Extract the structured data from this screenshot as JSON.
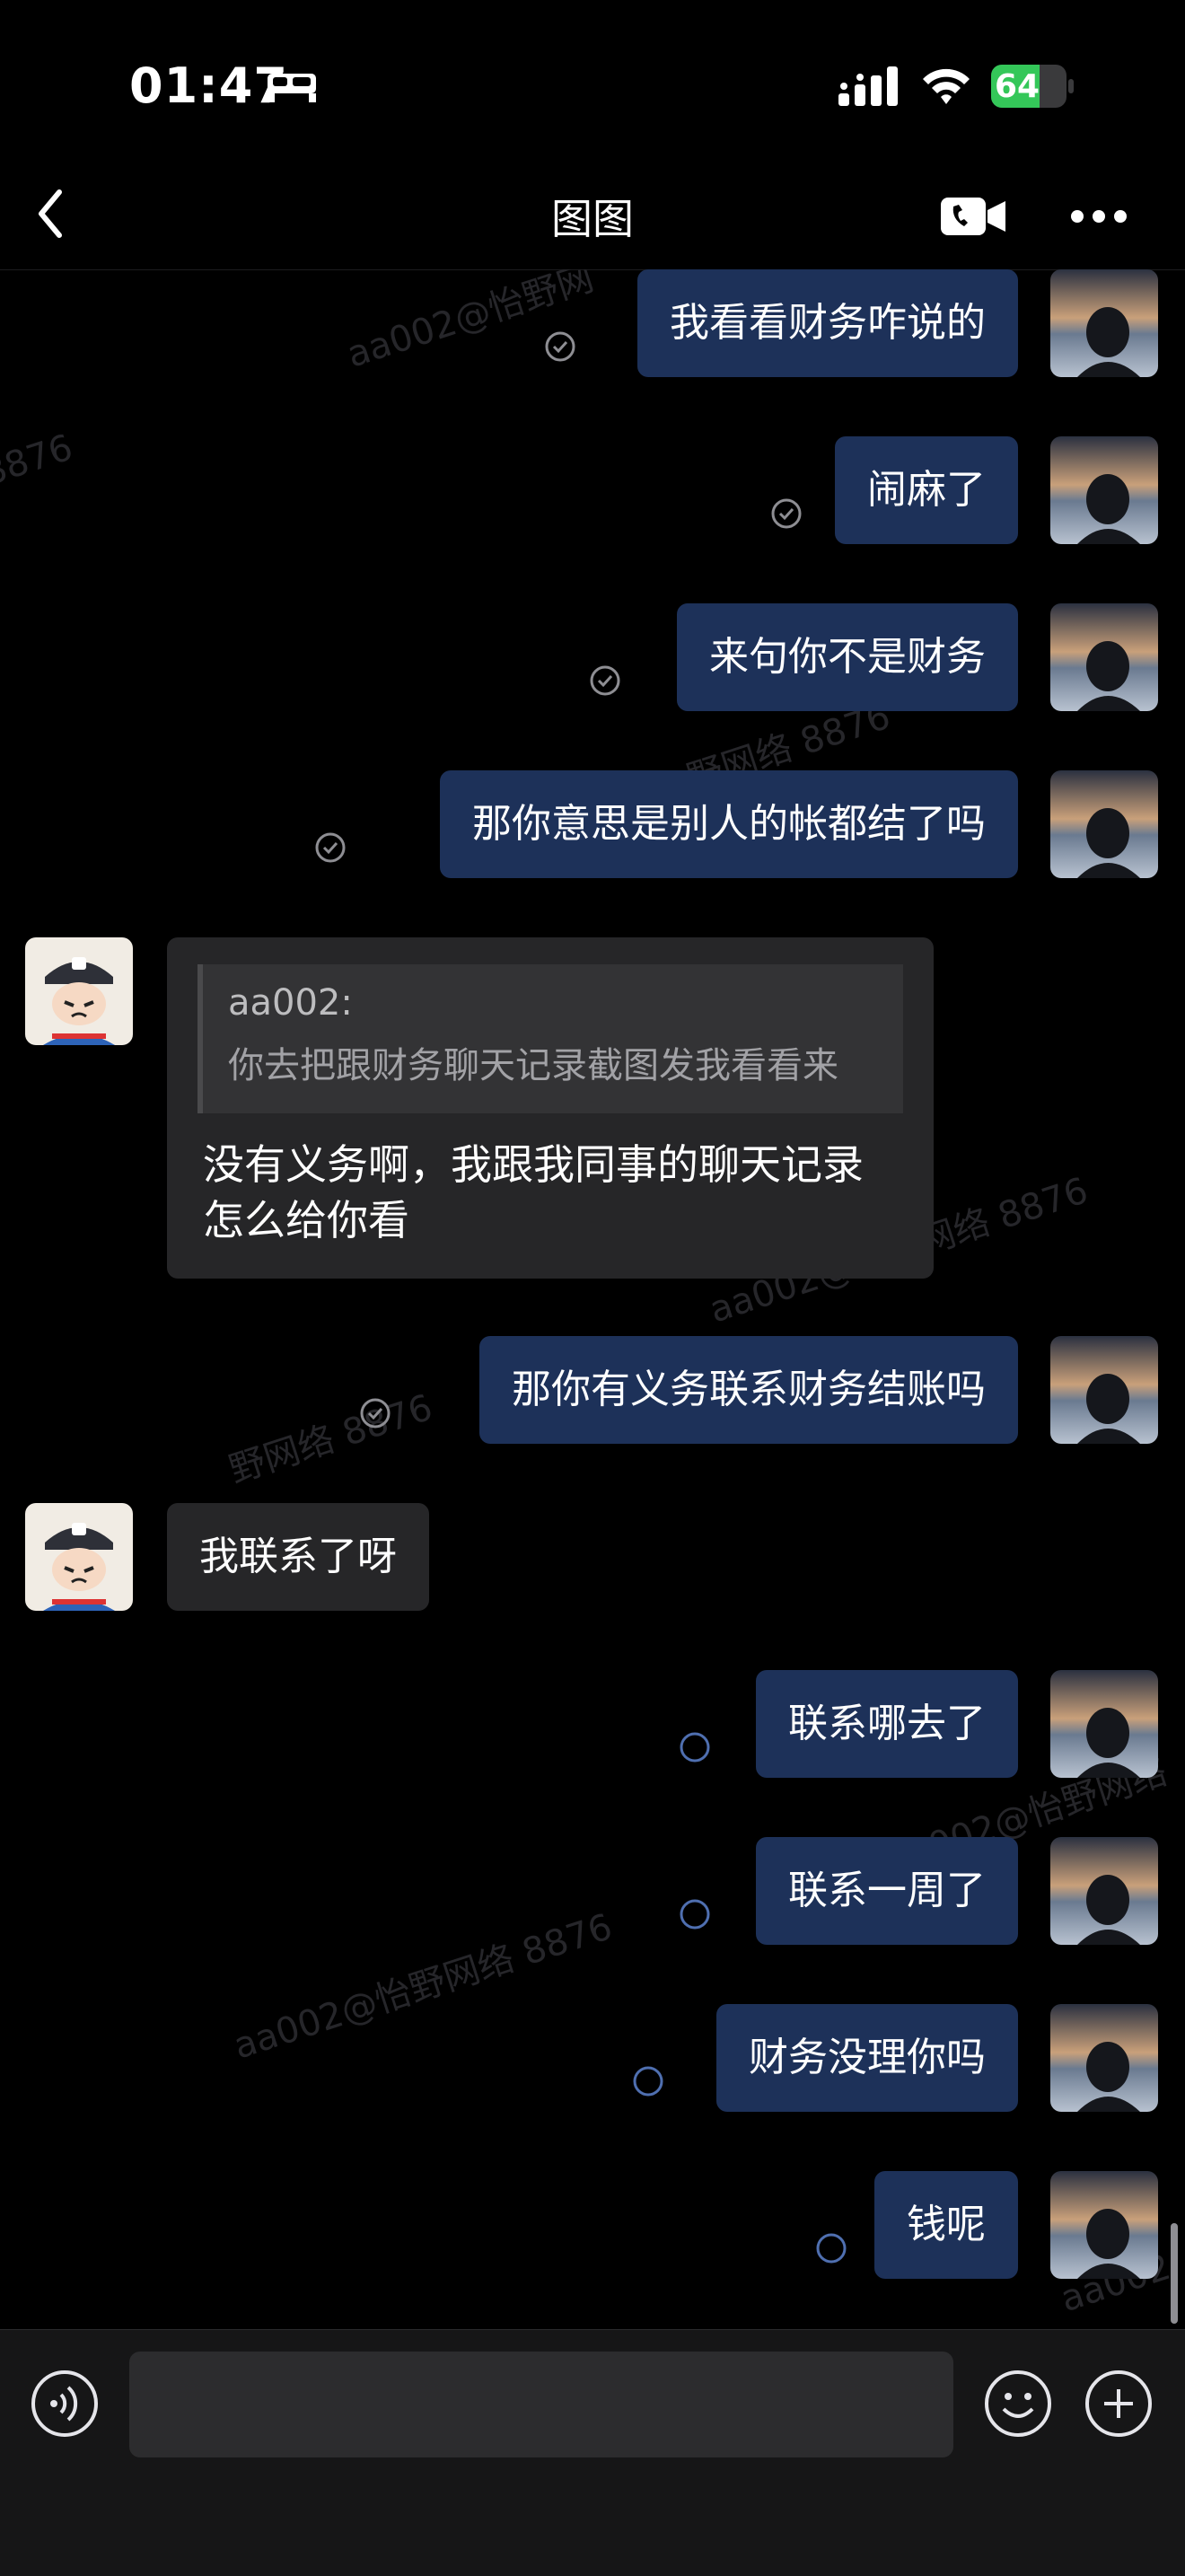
{
  "status_bar": {
    "time": "01:47",
    "battery": "64",
    "battery_level_percent": 64
  },
  "header": {
    "title": "图图"
  },
  "watermarks": [
    "aa002@怡野网",
    "8876",
    "野网络 8876",
    "aa002@怡野网络 8876",
    "野网络 8876",
    "aa002@怡野网络",
    "aa002@怡野网络 8876",
    "aa002"
  ],
  "messages": [
    {
      "sender": "me",
      "text": "我看看财务咋说的",
      "status": "read"
    },
    {
      "sender": "me",
      "text": "闹麻了",
      "status": "read"
    },
    {
      "sender": "me",
      "text": "来句你不是财务",
      "status": "read"
    },
    {
      "sender": "me",
      "text": "那你意思是别人的帐都结了吗",
      "status": "read"
    },
    {
      "sender": "other",
      "quote_author": "aa002:",
      "quote_text": "你去把跟财务聊天记录截图发我看看来",
      "text": "没有义务啊，我跟我同事的聊天记录怎么给你看"
    },
    {
      "sender": "me",
      "text": "那你有义务联系财务结账吗",
      "status": "read"
    },
    {
      "sender": "other",
      "text": "我联系了呀"
    },
    {
      "sender": "me",
      "text": "联系哪去了",
      "status": "unread"
    },
    {
      "sender": "me",
      "text": "联系一周了",
      "status": "unread"
    },
    {
      "sender": "me",
      "text": "财务没理你吗",
      "status": "unread"
    },
    {
      "sender": "me",
      "text": "钱呢",
      "status": "unread"
    }
  ],
  "input": {
    "value": "",
    "placeholder": ""
  },
  "colors": {
    "my_bubble": "#1d3159",
    "other_bubble": "#262628",
    "background": "#000000",
    "input_bar": "#161617"
  },
  "icons": [
    "bed-icon",
    "signal-icon",
    "wifi-icon",
    "back-icon",
    "video-call-icon",
    "more-icon",
    "read-check-icon",
    "sending-circle-icon",
    "voice-icon",
    "emoji-icon",
    "plus-icon"
  ]
}
